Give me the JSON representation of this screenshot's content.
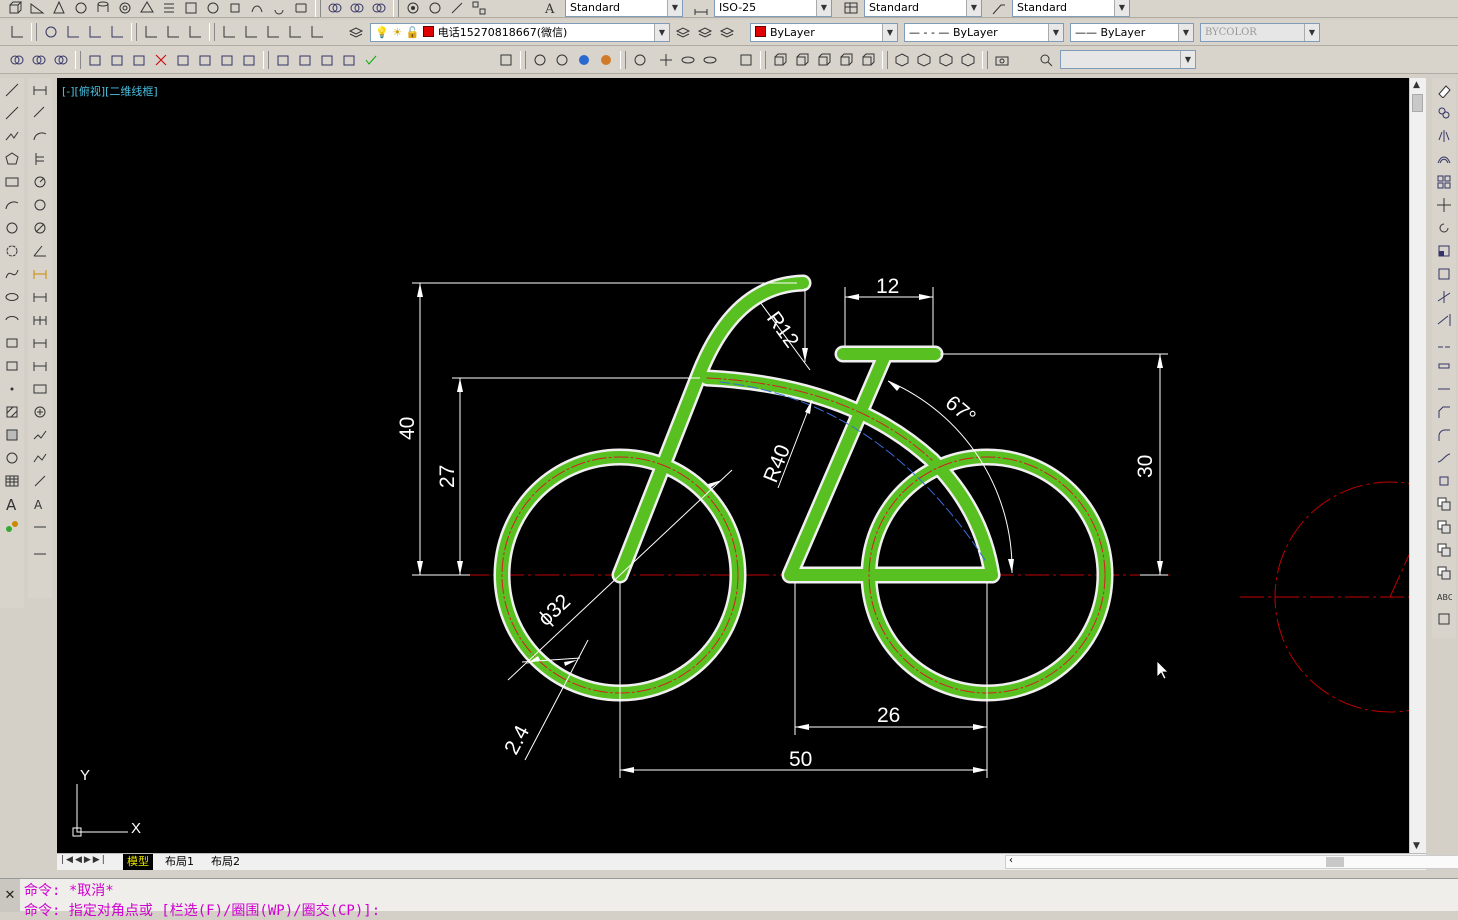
{
  "toolbars": {
    "row1": {
      "text_style": "Standard",
      "dim_style": "ISO-25",
      "table_style": "Standard",
      "mleader_style": "Standard"
    },
    "row2": {
      "layer": "电话15270818667(微信)",
      "color": "ByLayer",
      "linetype": "ByLayer",
      "lineweight": "ByLayer",
      "plotstyle": "BYCOLOR"
    }
  },
  "viewport": {
    "label": "[-][俯视][二维线框]"
  },
  "drawing": {
    "colors": {
      "frame": "#58c020",
      "outline": "#f0f0f0",
      "dim": "#ffffff",
      "center": "#c00000"
    },
    "dimensions": [
      "12",
      "R12",
      "67°",
      "40",
      "27",
      "R40",
      "30",
      "ϕ32",
      "2.4",
      "26",
      "50"
    ],
    "ucs": {
      "x": "X",
      "y": "Y"
    }
  },
  "tabs": [
    "模型",
    "布局1",
    "布局2"
  ],
  "command": {
    "line1": "命令: *取消*",
    "line2": "命令: 指定对角点或 [栏选(F)/圈围(WP)/圈交(CP)]:"
  }
}
